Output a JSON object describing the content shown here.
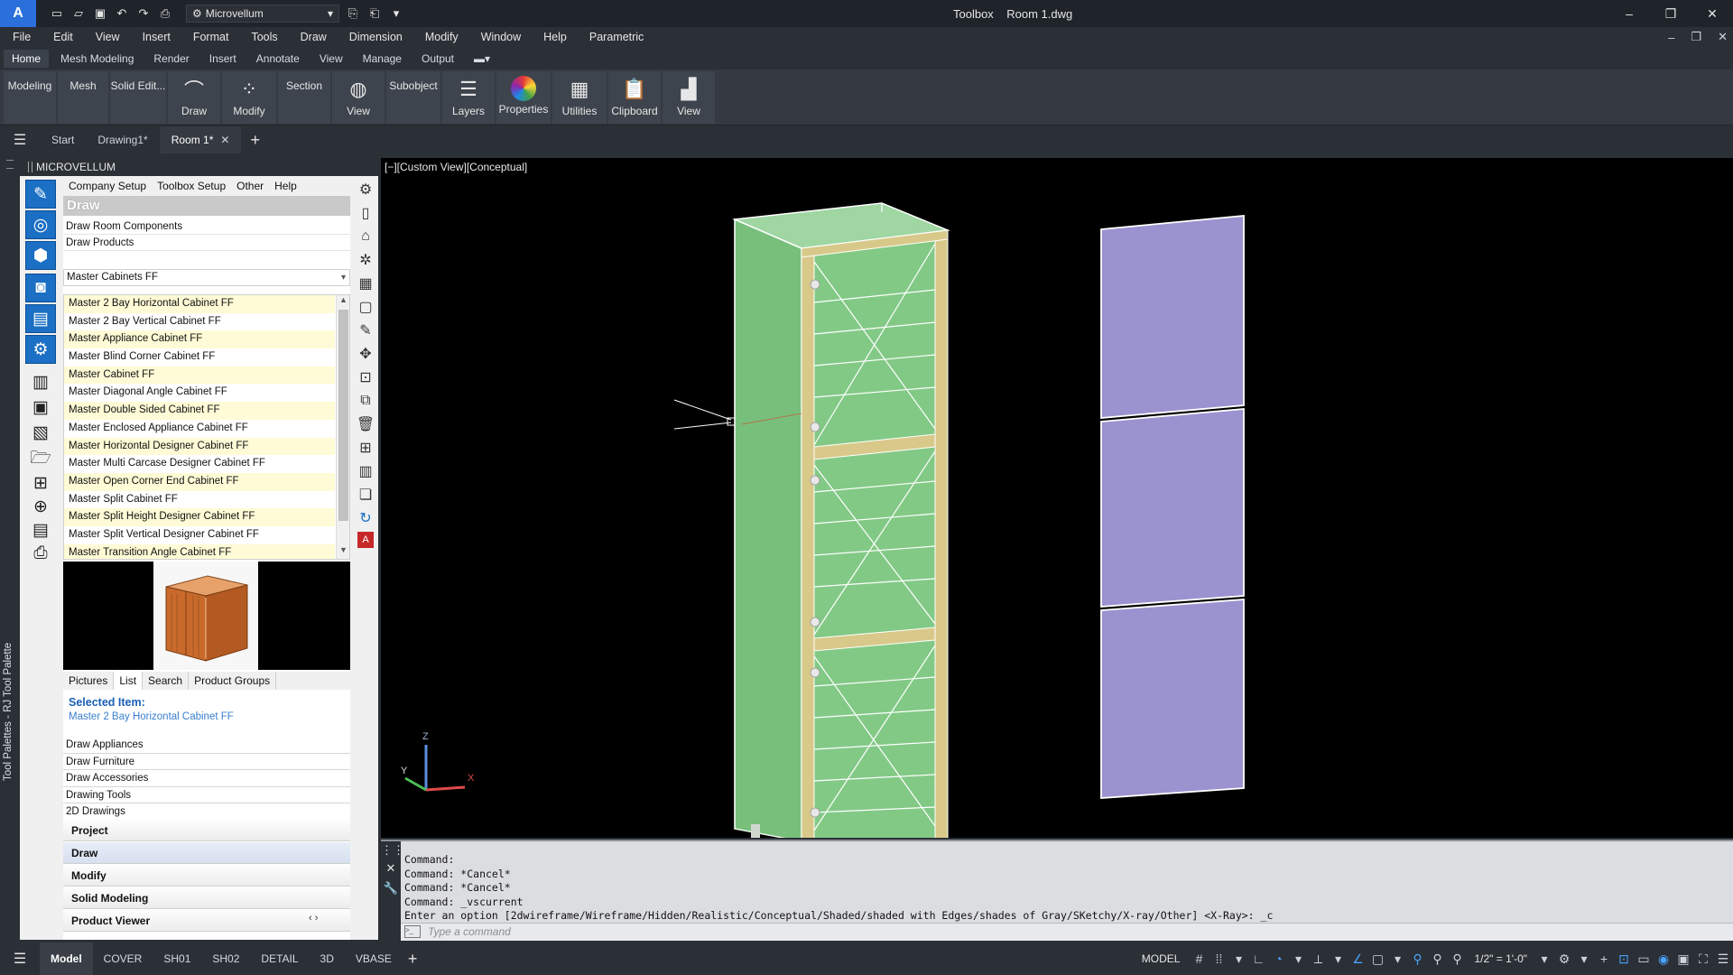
{
  "titlebar": {
    "app_logo": "A",
    "workspace": "Microvellum",
    "title": "Toolbox    Room 1.dwg",
    "min": "–",
    "max": "❐",
    "close": "✕"
  },
  "menubar": [
    "File",
    "Edit",
    "View",
    "Insert",
    "Format",
    "Tools",
    "Draw",
    "Dimension",
    "Modify",
    "Window",
    "Help",
    "Parametric"
  ],
  "ribbon_tabs": [
    "Home",
    "Mesh Modeling",
    "Render",
    "Insert",
    "Annotate",
    "View",
    "Manage",
    "Output"
  ],
  "ribbon_buttons": {
    "modeling": "Modeling",
    "mesh": "Mesh",
    "solid_edit": "Solid Edit...",
    "draw": "Draw",
    "modify": "Modify",
    "section": "Section",
    "view": "View",
    "subobject": "Subobject",
    "layers": "Layers",
    "properties": "Properties",
    "utilities": "Utilities",
    "clipboard": "Clipboard",
    "view2": "View"
  },
  "doc_tabs": {
    "start": "Start",
    "drawing1": "Drawing1*",
    "room1": "Room 1*"
  },
  "palette": {
    "vertical_title": "Tool Palettes - RJ Tool Palette",
    "header": "MICROVELLUM",
    "menu": [
      "Company Setup",
      "Toolbox Setup",
      "Other",
      "Help"
    ],
    "section_title": "Draw",
    "draw_room_components": "Draw Room Components",
    "draw_products": "Draw Products",
    "library_select": "Master Cabinets FF",
    "products": [
      "Master 2 Bay Horizontal Cabinet FF",
      "Master 2 Bay Vertical Cabinet FF",
      "Master Appliance Cabinet FF",
      "Master Blind Corner Cabinet FF",
      "Master Cabinet FF",
      "Master Diagonal Angle Cabinet FF",
      "Master Double Sided Cabinet FF",
      "Master Enclosed Appliance Cabinet FF",
      "Master Horizontal Designer Cabinet FF",
      "Master Multi Carcase Designer Cabinet FF",
      "Master Open Corner End Cabinet FF",
      "Master Split Cabinet FF",
      "Master Split Height Designer Cabinet FF",
      "Master Split Vertical Designer Cabinet FF",
      "Master Transition Angle Cabinet FF"
    ],
    "view_tabs": [
      "Pictures",
      "List",
      "Search",
      "Product Groups"
    ],
    "selected_label": "Selected Item:",
    "selected_value": "Master 2 Bay Horizontal Cabinet FF",
    "draw_links": [
      "Draw Appliances",
      "Draw Furniture",
      "Draw Accessories",
      "Drawing Tools",
      "2D Drawings"
    ],
    "groups": [
      "Project",
      "Draw",
      "Modify",
      "Solid Modeling",
      "Product Viewer"
    ]
  },
  "viewport": {
    "label": "[−][Custom View][Conceptual]",
    "axis_x": "X",
    "axis_y": "Y",
    "axis_z": "Z",
    "colors": {
      "cabinet": "#7bc47f",
      "doors": "#9a93cf",
      "frame": "#d8c98a"
    }
  },
  "command": {
    "lines": [
      "Command:",
      "Command: *Cancel*",
      "Command: *Cancel*",
      "Command: _vscurrent",
      "Enter an option [2dwireframe/Wireframe/Hidden/Realistic/Conceptual/Shaded/shaded with Edges/shades of Gray/SKetchy/X-ray/Other] <X-Ray>: _c"
    ],
    "placeholder": "Type a command"
  },
  "layout_tabs": [
    "Model",
    "COVER",
    "SH01",
    "SH02",
    "DETAIL",
    "3D",
    "VBASE"
  ],
  "status": {
    "model": "MODEL",
    "scale": "1/2\" = 1'-0\""
  }
}
